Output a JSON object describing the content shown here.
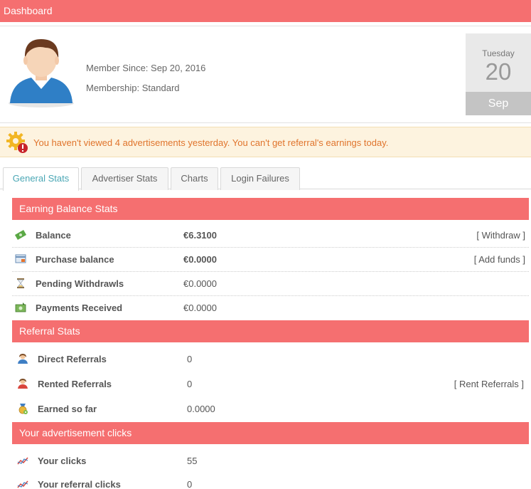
{
  "header": {
    "title": "Dashboard"
  },
  "profile": {
    "member_since": "Member Since: Sep 20, 2016",
    "membership": "Membership: Standard"
  },
  "date": {
    "weekday": "Tuesday",
    "day": "20",
    "month": "Sep"
  },
  "alert": {
    "message": "You haven't viewed 4 advertisements yesterday. You can't get referral's earnings today."
  },
  "tabs": [
    {
      "label": "General Stats"
    },
    {
      "label": "Advertiser Stats"
    },
    {
      "label": "Charts"
    },
    {
      "label": "Login Failures"
    }
  ],
  "earning": {
    "title": "Earning Balance Stats",
    "rows": [
      {
        "label": "Balance",
        "value": "€6.3100",
        "action": "[ Withdraw ]",
        "icon": "money-icon"
      },
      {
        "label": "Purchase balance",
        "value": "€0.0000",
        "action": "[ Add funds ]",
        "icon": "card-icon"
      },
      {
        "label": "Pending Withdrawls",
        "value": "€0.0000",
        "icon": "hourglass-icon"
      },
      {
        "label": "Payments Received",
        "value": "€0.0000",
        "icon": "cash-icon"
      }
    ]
  },
  "referral": {
    "title": "Referral Stats",
    "rows": [
      {
        "label": "Direct Referrals",
        "value": "0",
        "icon": "user-blue-icon"
      },
      {
        "label": "Rented Referrals",
        "value": "0",
        "action": "[ Rent Referrals ]",
        "icon": "user-red-icon"
      },
      {
        "label": "Earned so far",
        "value": "0.0000",
        "icon": "medal-icon"
      }
    ]
  },
  "clicks": {
    "title": "Your advertisement clicks",
    "rows": [
      {
        "label": "Your clicks",
        "value": "55",
        "icon": "chart-line-icon"
      },
      {
        "label": "Your referral clicks",
        "value": "0",
        "icon": "chart-line-icon"
      }
    ]
  },
  "colors": {
    "accent": "#f56f70",
    "alert_text": "#e0742c",
    "tab_active": "#4aa7b5"
  }
}
